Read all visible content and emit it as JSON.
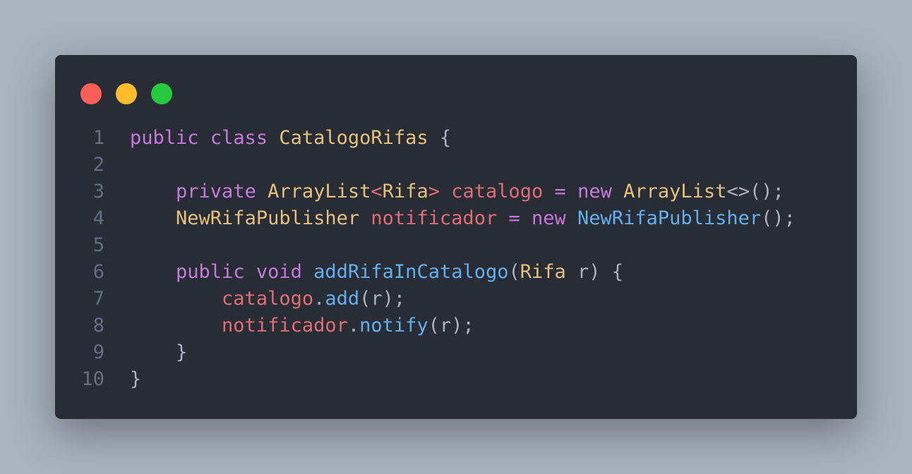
{
  "colors": {
    "background": "#a8b3bf",
    "editor_bg": "#282c34",
    "close": "#ff5f56",
    "minimize": "#ffbd2e",
    "maximize": "#27c93f",
    "line_number": "#636d83",
    "keyword": "#c678dd",
    "type": "#e5c07b",
    "variable": "#e06c75",
    "function": "#61afef",
    "plain": "#abb2bf"
  },
  "window_controls": [
    "close",
    "minimize",
    "maximize"
  ],
  "code": {
    "lines": [
      {
        "n": "1",
        "tokens": [
          [
            "keyword",
            "public"
          ],
          [
            "plain",
            " "
          ],
          [
            "keyword",
            "class"
          ],
          [
            "plain",
            " "
          ],
          [
            "type",
            "CatalogoRifas"
          ],
          [
            "plain",
            " {"
          ]
        ]
      },
      {
        "n": "2",
        "tokens": []
      },
      {
        "n": "3",
        "tokens": [
          [
            "plain",
            "    "
          ],
          [
            "keyword",
            "private"
          ],
          [
            "plain",
            " "
          ],
          [
            "type",
            "ArrayList"
          ],
          [
            "var",
            "<"
          ],
          [
            "type",
            "Rifa"
          ],
          [
            "var",
            ">"
          ],
          [
            "plain",
            " "
          ],
          [
            "var",
            "catalogo"
          ],
          [
            "plain",
            " "
          ],
          [
            "keyword",
            "="
          ],
          [
            "plain",
            " "
          ],
          [
            "keyword",
            "new"
          ],
          [
            "plain",
            " "
          ],
          [
            "type",
            "ArrayList"
          ],
          [
            "plain",
            "<>();"
          ]
        ]
      },
      {
        "n": "4",
        "tokens": [
          [
            "plain",
            "    "
          ],
          [
            "type",
            "NewRifaPublisher"
          ],
          [
            "plain",
            " "
          ],
          [
            "var",
            "notificador"
          ],
          [
            "plain",
            " "
          ],
          [
            "keyword",
            "="
          ],
          [
            "plain",
            " "
          ],
          [
            "keyword",
            "new"
          ],
          [
            "plain",
            " "
          ],
          [
            "func",
            "NewRifaPublisher"
          ],
          [
            "plain",
            "();"
          ]
        ]
      },
      {
        "n": "5",
        "tokens": []
      },
      {
        "n": "6",
        "tokens": [
          [
            "plain",
            "    "
          ],
          [
            "keyword",
            "public"
          ],
          [
            "plain",
            " "
          ],
          [
            "keyword",
            "void"
          ],
          [
            "plain",
            " "
          ],
          [
            "func",
            "addRifaInCatalogo"
          ],
          [
            "plain",
            "("
          ],
          [
            "type",
            "Rifa"
          ],
          [
            "plain",
            " r) {"
          ]
        ]
      },
      {
        "n": "7",
        "tokens": [
          [
            "plain",
            "        "
          ],
          [
            "var",
            "catalogo"
          ],
          [
            "plain",
            "."
          ],
          [
            "func",
            "add"
          ],
          [
            "plain",
            "(r);"
          ]
        ]
      },
      {
        "n": "8",
        "tokens": [
          [
            "plain",
            "        "
          ],
          [
            "var",
            "notificador"
          ],
          [
            "plain",
            "."
          ],
          [
            "func",
            "notify"
          ],
          [
            "plain",
            "(r);"
          ]
        ]
      },
      {
        "n": "9",
        "tokens": [
          [
            "plain",
            "    }"
          ]
        ]
      },
      {
        "n": "10",
        "tokens": [
          [
            "plain",
            "}"
          ]
        ]
      }
    ]
  }
}
